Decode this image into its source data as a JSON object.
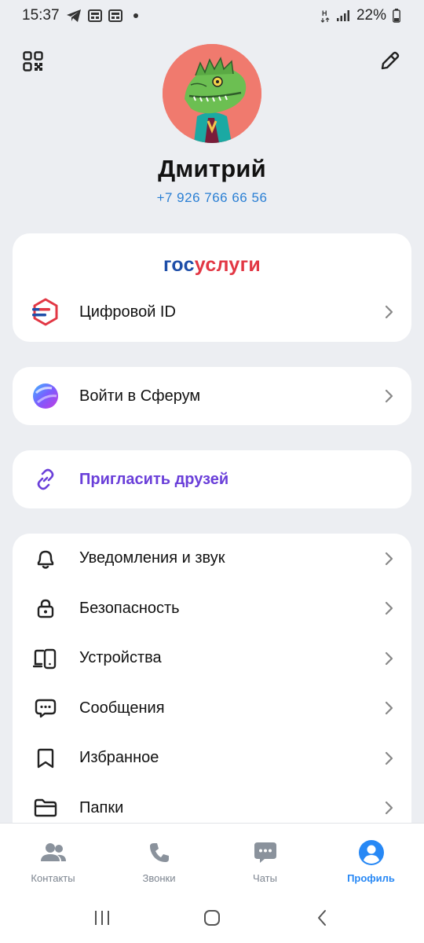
{
  "status_bar": {
    "time": "15:37",
    "battery": "22%"
  },
  "profile": {
    "name": "Дмитрий",
    "phone": "+7 926 766 66 56"
  },
  "gosuslugi": {
    "logo_part1": "гос",
    "logo_part2": "услуги",
    "digital_id_label": "Цифровой ID"
  },
  "sferum": {
    "label": "Войти в Сферум"
  },
  "invite": {
    "label": "Пригласить друзей"
  },
  "settings": {
    "items": [
      {
        "label": "Уведомления и звук",
        "icon": "bell-icon"
      },
      {
        "label": "Безопасность",
        "icon": "lock-icon"
      },
      {
        "label": "Устройства",
        "icon": "devices-icon"
      },
      {
        "label": "Сообщения",
        "icon": "chat-bubble-icon"
      },
      {
        "label": "Избранное",
        "icon": "bookmark-icon"
      },
      {
        "label": "Папки",
        "icon": "folder-icon"
      }
    ]
  },
  "bottom_nav": {
    "items": [
      {
        "label": "Контакты",
        "icon": "contacts-icon"
      },
      {
        "label": "Звонки",
        "icon": "phone-icon"
      },
      {
        "label": "Чаты",
        "icon": "chats-icon"
      },
      {
        "label": "Профиль",
        "icon": "profile-icon"
      }
    ],
    "active": "Профиль"
  },
  "colors": {
    "accent": "#2788f5",
    "invite": "#6a3fd9",
    "gos_blue": "#1e4ea8",
    "gos_red": "#e23744"
  }
}
